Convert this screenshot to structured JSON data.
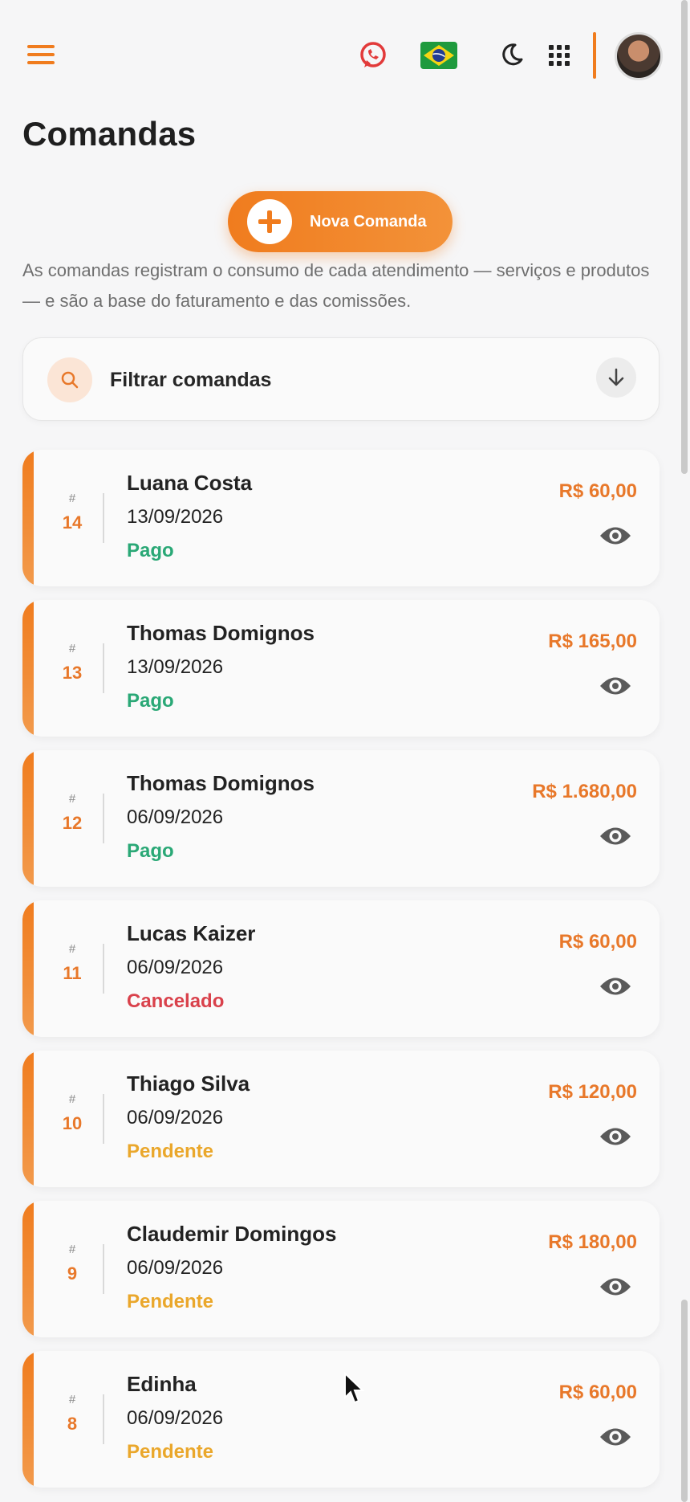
{
  "header": {
    "menu_icon": "hamburger-icon",
    "whatsapp_icon": "whatsapp-icon",
    "flag_icon": "brazil-flag-icon",
    "theme_icon": "moon-icon",
    "apps_icon": "apps-grid-icon",
    "accent_color": "#f07c1e"
  },
  "page": {
    "title": "Comandas",
    "new_button_label": "Nova Comanda",
    "description": "As comandas registram o consumo de cada atendimento — serviços e produtos — e são a base do faturamento e das comissões.",
    "filter_label": "Filtrar comandas"
  },
  "status_colors": {
    "Pago": "#2aa876",
    "Cancelado": "#d9414b",
    "Pendente": "#eaa72b"
  },
  "orders": [
    {
      "number": "14",
      "client": "Luana Costa",
      "date": "13/09/2026",
      "status": "Pago",
      "amount": "R$ 60,00"
    },
    {
      "number": "13",
      "client": "Thomas Domignos",
      "date": "13/09/2026",
      "status": "Pago",
      "amount": "R$ 165,00"
    },
    {
      "number": "12",
      "client": "Thomas Domignos",
      "date": "06/09/2026",
      "status": "Pago",
      "amount": "R$ 1.680,00"
    },
    {
      "number": "11",
      "client": "Lucas Kaizer",
      "date": "06/09/2026",
      "status": "Cancelado",
      "amount": "R$ 60,00"
    },
    {
      "number": "10",
      "client": "Thiago Silva",
      "date": "06/09/2026",
      "status": "Pendente",
      "amount": "R$ 120,00"
    },
    {
      "number": "9",
      "client": "Claudemir Domingos",
      "date": "06/09/2026",
      "status": "Pendente",
      "amount": "R$ 180,00"
    },
    {
      "number": "8",
      "client": "Edinha",
      "date": "06/09/2026",
      "status": "Pendente",
      "amount": "R$ 60,00"
    }
  ]
}
